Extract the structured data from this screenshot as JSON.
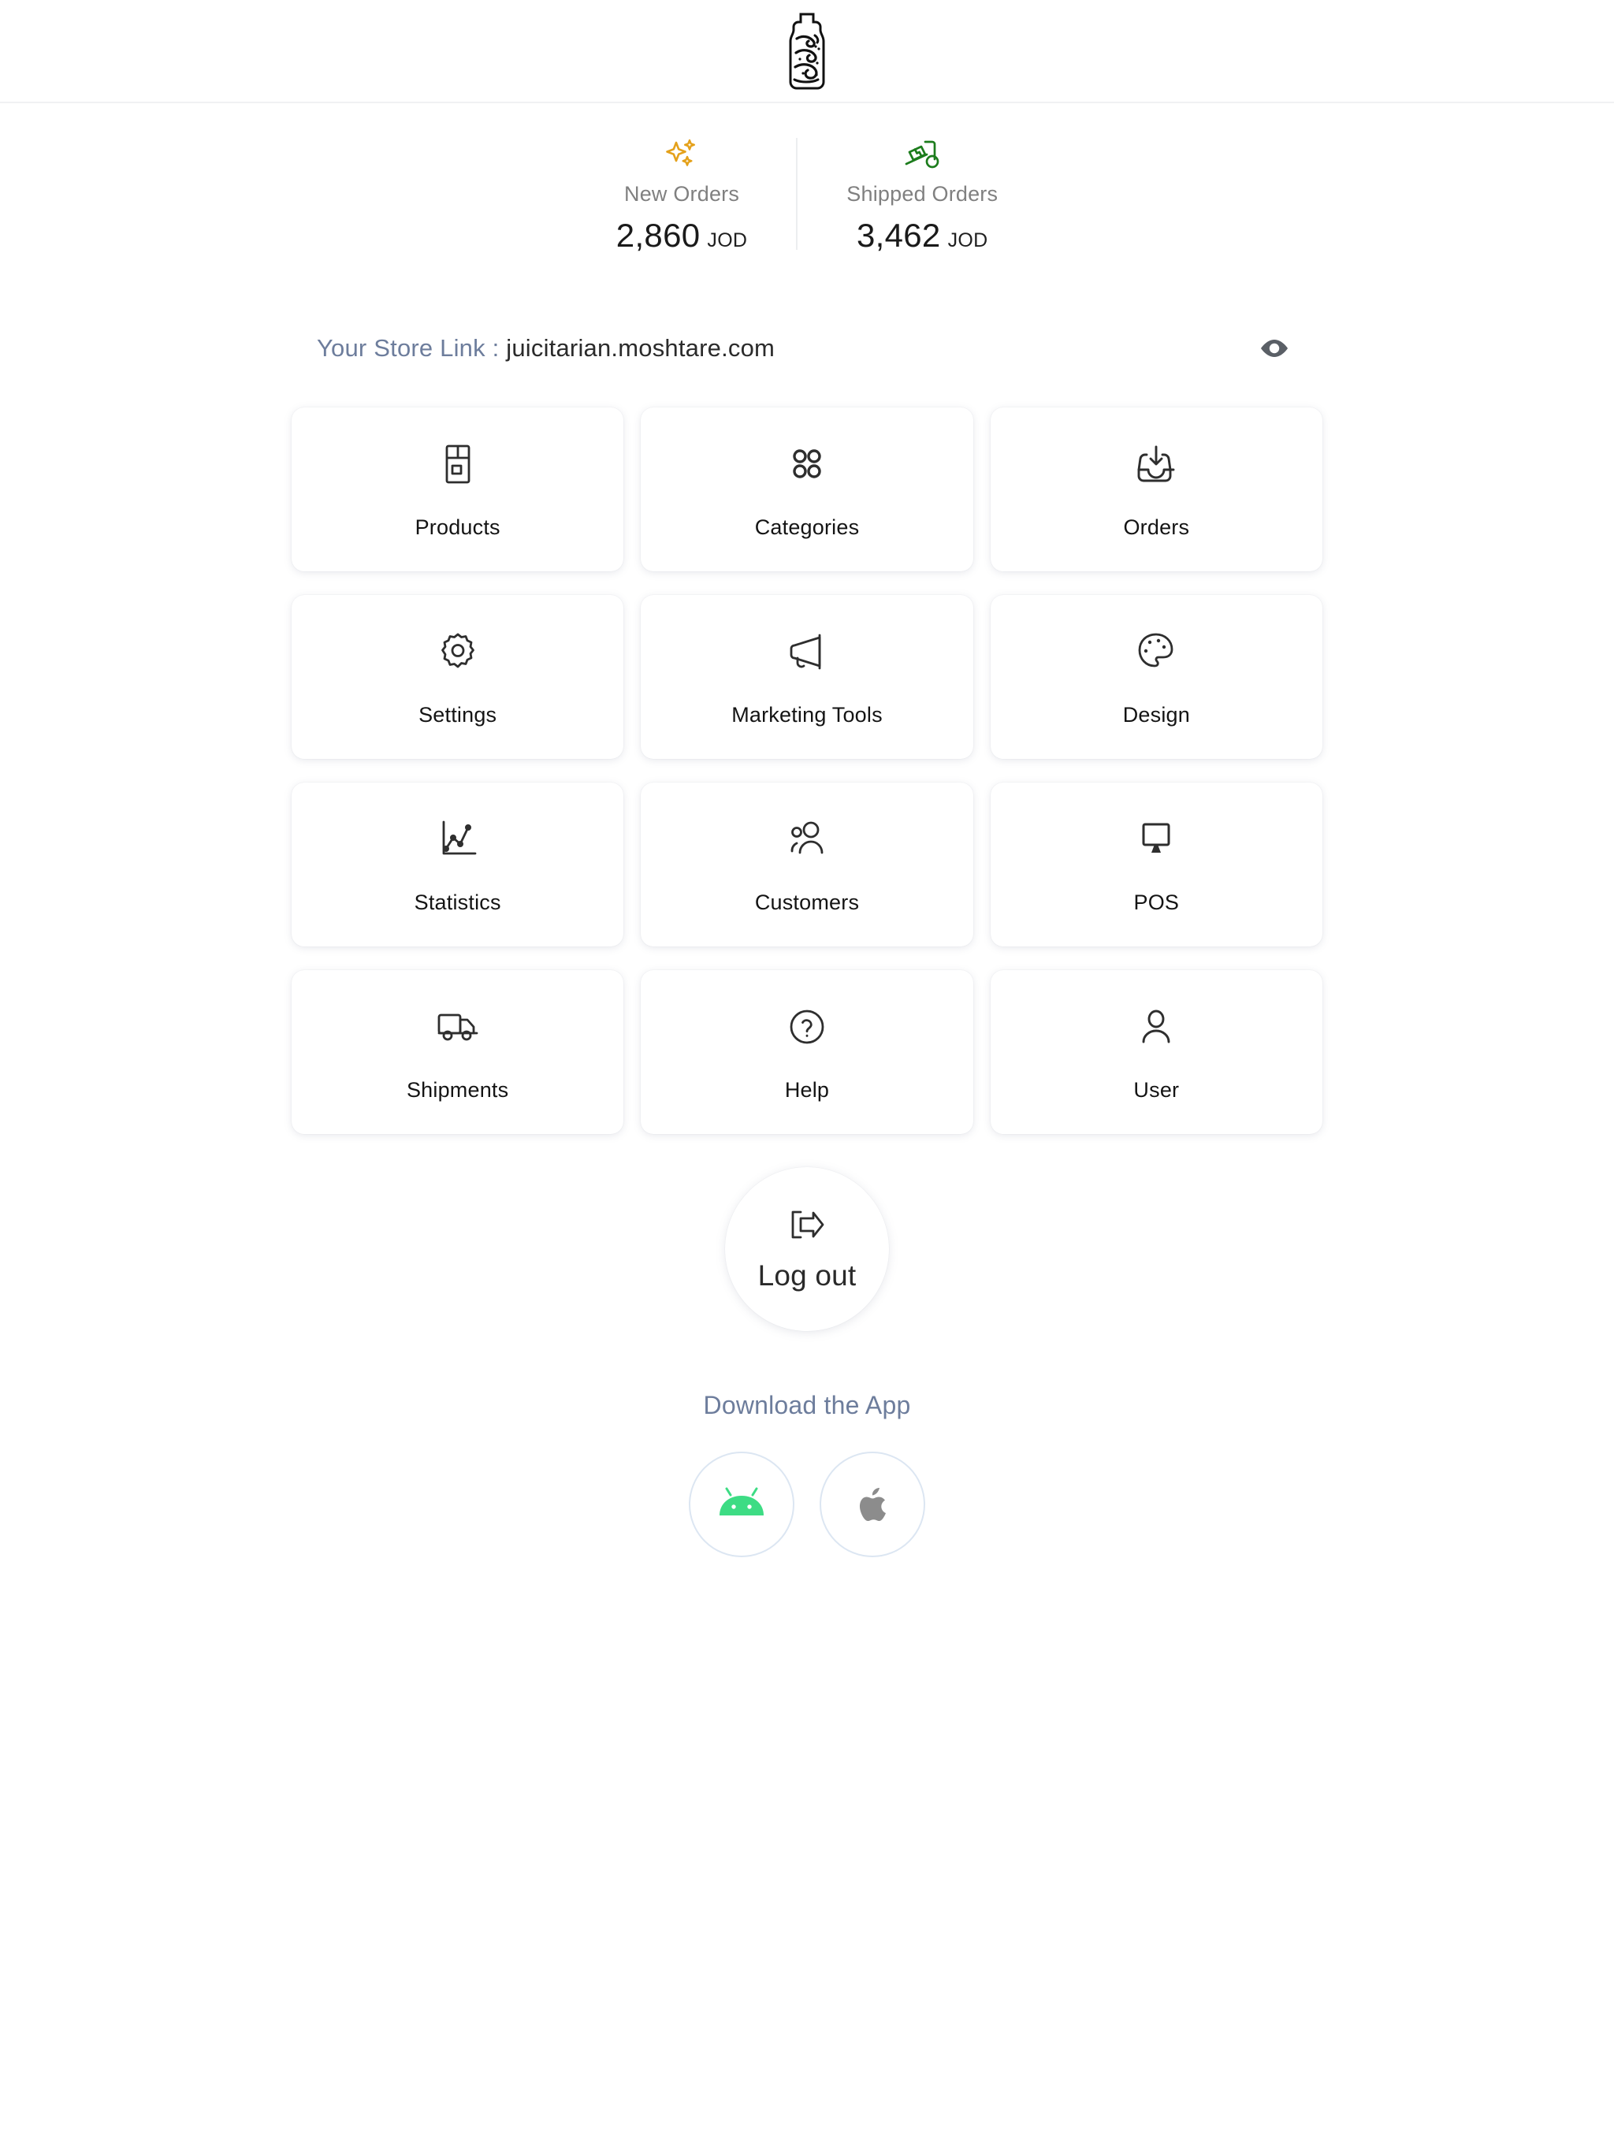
{
  "header": {
    "logo_name": "juicitarian-bottle-logo",
    "logo_alt": "Bottle with Arabic calligraphy"
  },
  "stats": [
    {
      "icon": "sparkles-icon",
      "icon_color": "#E4A11B",
      "label": "New Orders",
      "value": "2,860",
      "currency": "JOD"
    },
    {
      "icon": "delivery-dolly-icon",
      "icon_color": "#1C7C1C",
      "label": "Shipped Orders",
      "value": "3,462",
      "currency": "JOD"
    }
  ],
  "store_link": {
    "label": "Your Store Link :",
    "url": "juicitarian.moshtare.com",
    "label_color": "#6d7d9c",
    "eye_icon": "eye-icon"
  },
  "tiles": [
    {
      "id": "products",
      "label": "Products",
      "icon": "package-box-icon"
    },
    {
      "id": "categories",
      "label": "Categories",
      "icon": "grid-circles-icon"
    },
    {
      "id": "orders",
      "label": "Orders",
      "icon": "inbox-download-icon"
    },
    {
      "id": "settings",
      "label": "Settings",
      "icon": "gear-icon"
    },
    {
      "id": "marketing-tools",
      "label": "Marketing Tools",
      "icon": "megaphone-icon"
    },
    {
      "id": "design",
      "label": "Design",
      "icon": "paint-palette-icon"
    },
    {
      "id": "statistics",
      "label": "Statistics",
      "icon": "line-chart-icon"
    },
    {
      "id": "customers",
      "label": "Customers",
      "icon": "users-icon"
    },
    {
      "id": "pos",
      "label": "POS",
      "icon": "monitor-icon"
    },
    {
      "id": "shipments",
      "label": "Shipments",
      "icon": "truck-icon"
    },
    {
      "id": "help",
      "label": "Help",
      "icon": "question-circle-icon"
    },
    {
      "id": "user",
      "label": "User",
      "icon": "person-icon"
    }
  ],
  "logout": {
    "label": "Log out",
    "icon": "logout-arrow-icon"
  },
  "download": {
    "title": "Download the App",
    "title_color": "#6d7d9c",
    "buttons": [
      {
        "id": "android",
        "icon": "android-icon",
        "color": "#3DDC84"
      },
      {
        "id": "apple",
        "icon": "apple-icon",
        "color": "#8C8C8C"
      }
    ]
  }
}
